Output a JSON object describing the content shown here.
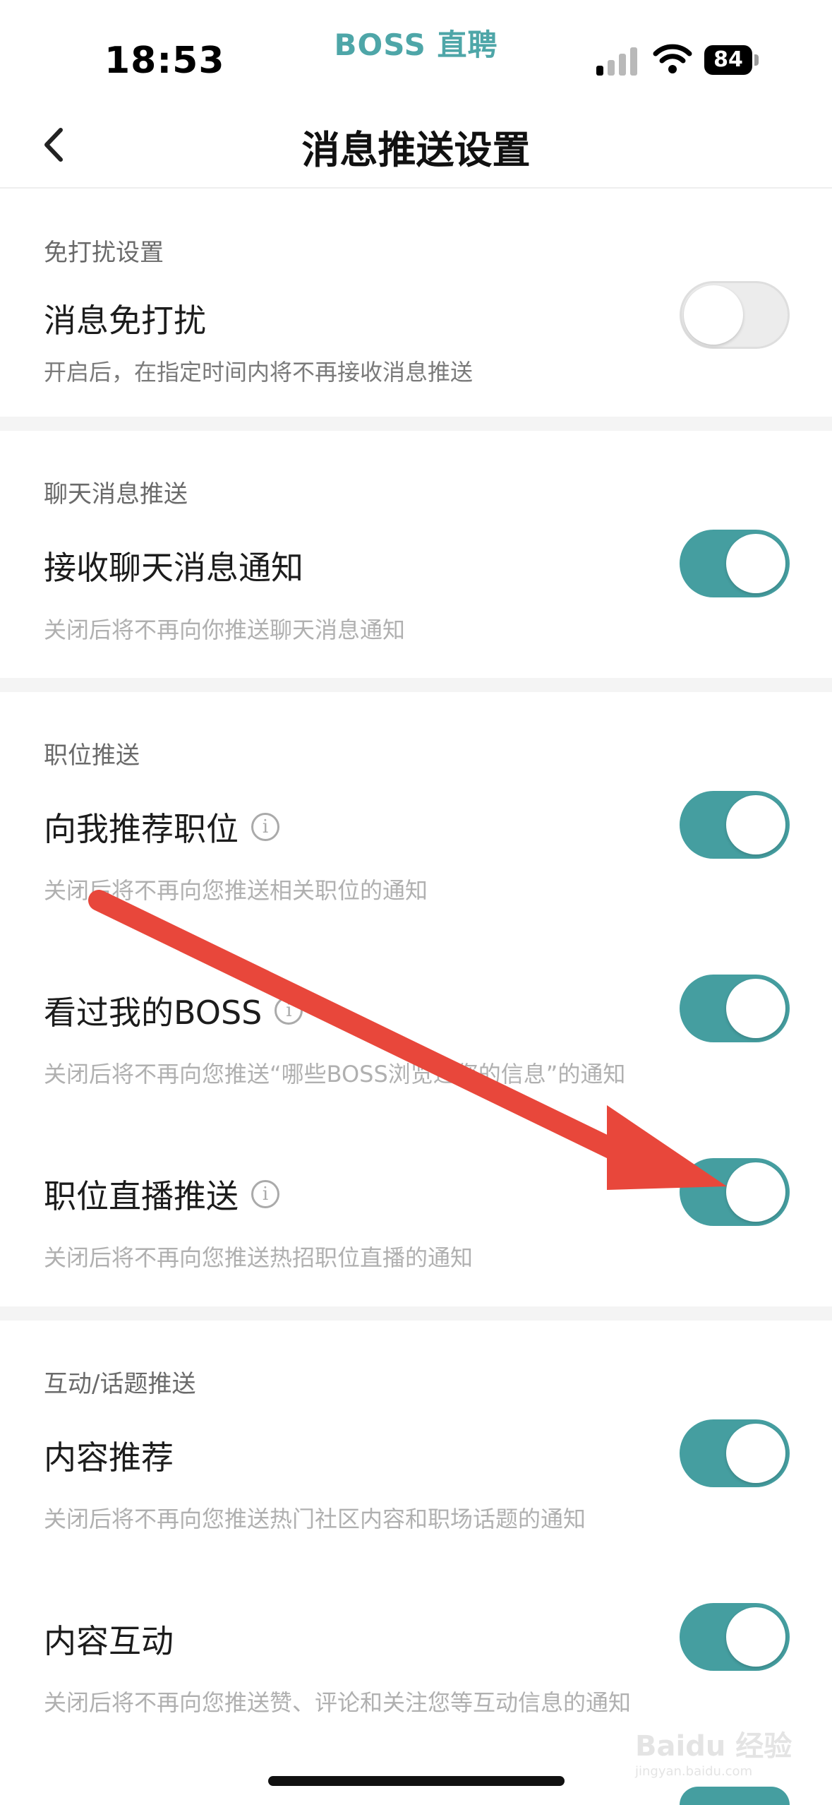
{
  "status_bar": {
    "time": "18:53",
    "brand": "BOSS 直聘",
    "battery": "84"
  },
  "nav": {
    "back_icon": "chevron-left-icon",
    "title": "消息推送设置"
  },
  "sections": {
    "dnd": {
      "label": "免打扰设置",
      "row": {
        "title": "消息免打扰",
        "subtitle": "开启后，在指定时间内将不再接收消息推送",
        "toggle": "off"
      }
    },
    "chat": {
      "label": "聊天消息推送",
      "row": {
        "title": "接收聊天消息通知",
        "subtitle": "关闭后将不再向你推送聊天消息通知",
        "toggle": "on"
      }
    },
    "jobs": {
      "label": "职位推送",
      "rows": [
        {
          "title": "向我推荐职位",
          "subtitle": "关闭后将不再向您推送相关职位的通知",
          "toggle": "on",
          "info_icon": true
        },
        {
          "title": "看过我的BOSS",
          "subtitle": "关闭后将不再向您推送“哪些BOSS浏览过您的信息”的通知",
          "toggle": "on",
          "info_icon": true
        },
        {
          "title": "职位直播推送",
          "subtitle": "关闭后将不再向您推送热招职位直播的通知",
          "toggle": "on",
          "info_icon": true
        }
      ]
    },
    "interaction": {
      "label": "互动/话题推送",
      "rows": [
        {
          "title": "内容推荐",
          "subtitle": "关闭后将不再向您推送热门社区内容和职场话题的通知",
          "toggle": "on"
        },
        {
          "title": "内容互动",
          "subtitle": "关闭后将不再向您推送赞、评论和关注您等互动信息的通知",
          "toggle": "on"
        }
      ]
    }
  },
  "info_glyph": "i",
  "watermark": {
    "text": "Baidu 经验",
    "sub": "jingyan.baidu.com"
  },
  "colors": {
    "accent": "#459ea0",
    "brand": "#4ea6a8",
    "arrow": "#e8473b"
  }
}
